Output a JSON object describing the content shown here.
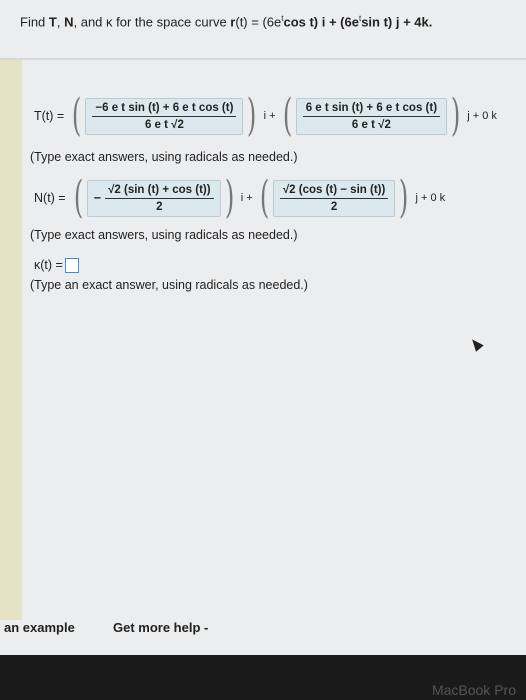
{
  "question": {
    "prefix": "Find ",
    "T": "T",
    "comma1": ", ",
    "N": "N",
    "and": ", and κ for the space curve ",
    "r": "r",
    "formula": "(t) = (6e",
    "exp1": "t",
    "cos_part": "cos t) i + (6e",
    "exp2": "t",
    "sin_part": "sin t) j + 4k."
  },
  "T_row": {
    "label": "T(t) =",
    "num1": "−6 e t sin (t) + 6 e t cos (t)",
    "den1": "6 e t √2",
    "unit1": "i +",
    "num2": "6 e t sin (t) + 6 e t cos (t)",
    "den2": "6 e t √2",
    "tail": "j + 0 k"
  },
  "T_hint": "(Type exact answers, using radicals as needed.)",
  "N_row": {
    "label": "N(t) =",
    "minus": "−",
    "num1": "√2 (sin (t) + cos (t))",
    "den1": "2",
    "unit1": "i +",
    "num2": "√2 (cos (t) − sin (t))",
    "den2": "2",
    "tail": "j + 0 k"
  },
  "N_hint": "(Type exact answers, using radicals as needed.)",
  "kappa": {
    "label": "κ(t) =",
    "value": ""
  },
  "kappa_hint": "(Type an exact answer, using radicals as needed.)",
  "footer": {
    "example": "an example",
    "help": "Get more help -"
  },
  "bezel_text": "MacBook Pro"
}
